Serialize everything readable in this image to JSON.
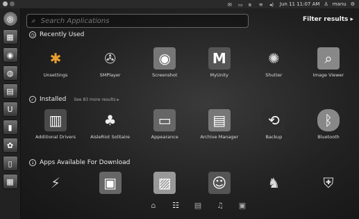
{
  "topbar": {
    "clock": "Jun 11 11:07 AM",
    "user": "manu"
  },
  "search": {
    "placeholder": "Search Applications"
  },
  "filter": {
    "label": "Filter results ▸"
  },
  "sections": {
    "recent": {
      "title": "Recently Used",
      "apps": [
        {
          "label": "Unsettings",
          "icon": "gear-icon"
        },
        {
          "label": "SMPlayer",
          "icon": "film-reel-icon"
        },
        {
          "label": "Screenshot",
          "icon": "camera-icon"
        },
        {
          "label": "MyUnity",
          "icon": "m-logo-icon"
        },
        {
          "label": "Shutter",
          "icon": "shutter-icon"
        },
        {
          "label": "Image Viewer",
          "icon": "magnifier-image-icon"
        }
      ]
    },
    "installed": {
      "title": "Installed",
      "see_more": "See 83 more results ▸",
      "apps": [
        {
          "label": "Additional Drivers",
          "icon": "driver-board-icon"
        },
        {
          "label": "AisleRiot Solitaire",
          "icon": "cards-icon"
        },
        {
          "label": "Appearance",
          "icon": "monitor-icon"
        },
        {
          "label": "Archive Manager",
          "icon": "archive-icon"
        },
        {
          "label": "Backup",
          "icon": "backup-icon"
        },
        {
          "label": "Bluetooth",
          "icon": "bluetooth-icon"
        }
      ]
    },
    "download": {
      "title": "Apps Available For Download",
      "apps": [
        {
          "icon": "satellite-icon"
        },
        {
          "icon": "box-icon"
        },
        {
          "icon": "photo-icon"
        },
        {
          "icon": "portrait-icon"
        },
        {
          "icon": "figure-icon"
        },
        {
          "icon": "shield-icon"
        }
      ]
    }
  },
  "lenses": [
    {
      "name": "home-lens",
      "glyph": "⌂"
    },
    {
      "name": "applications-lens",
      "glyph": "☷"
    },
    {
      "name": "files-lens",
      "glyph": "▤"
    },
    {
      "name": "music-lens",
      "glyph": "♫"
    },
    {
      "name": "video-lens",
      "glyph": "▣"
    }
  ]
}
